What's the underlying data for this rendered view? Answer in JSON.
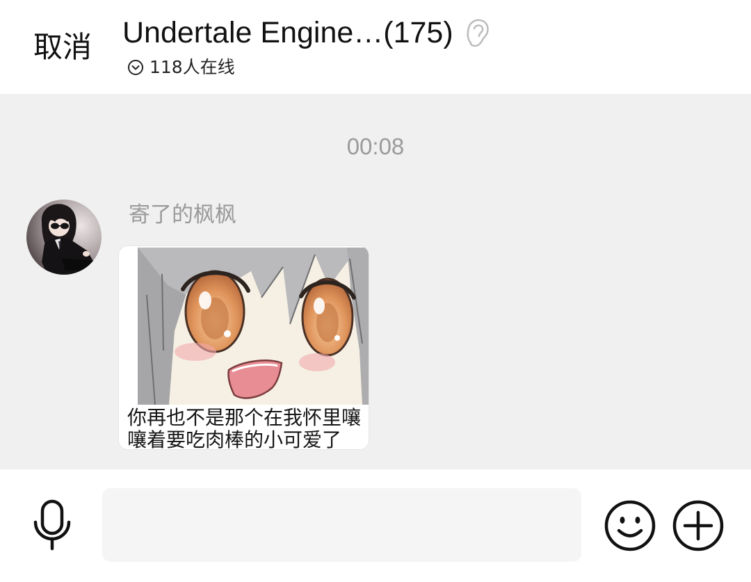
{
  "header": {
    "cancel_label": "取消",
    "title": "Undertale Engine…(175)",
    "ear_icon": "ear-icon",
    "online_icon": "chevron-down-circle-icon",
    "online_text": "118人在线"
  },
  "chat": {
    "timestamp": "00:08",
    "messages": [
      {
        "sender_name": "寄了的枫枫",
        "image_caption": [
          "你再也不是那个在我怀里嚷",
          "嚷着要吃肉棒的小可爱了"
        ]
      }
    ]
  },
  "composer": {
    "input_value": "",
    "mic_icon": "microphone-icon",
    "emoji_icon": "smiley-icon",
    "more_icon": "plus-circle-icon"
  },
  "colors": {
    "header_bg": "#ffffff",
    "chat_bg": "#f0f0f0",
    "composer_bg": "#ffffff",
    "input_bg": "#f5f5f5",
    "primary_text": "#111111",
    "secondary_text": "#9a9a9a"
  }
}
